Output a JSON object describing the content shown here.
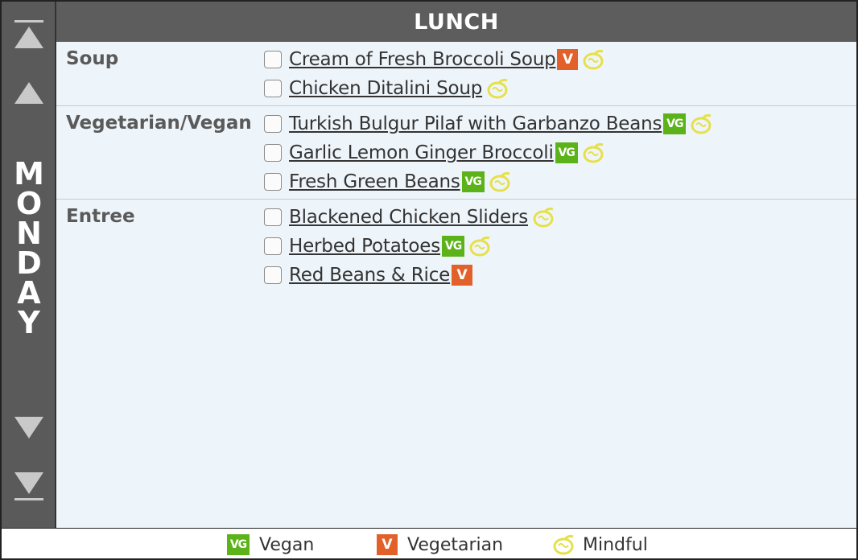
{
  "header": {
    "title": "LUNCH"
  },
  "sidebar": {
    "day_letters": [
      "M",
      "O",
      "N",
      "D",
      "A",
      "Y"
    ],
    "nav": {
      "first_label": "first",
      "prev_label": "previous",
      "next_label": "next",
      "last_label": "last"
    }
  },
  "sections": [
    {
      "category": "Soup",
      "items": [
        {
          "name": "Cream of Fresh Broccoli Soup",
          "badge": "V",
          "mindful": true
        },
        {
          "name": "Chicken Ditalini Soup",
          "badge": "",
          "mindful": true
        }
      ]
    },
    {
      "category": "Vegetarian/Vegan",
      "items": [
        {
          "name": "Turkish Bulgur Pilaf with Garbanzo Beans",
          "badge": "VG",
          "mindful": true
        },
        {
          "name": "Garlic Lemon Ginger Broccoli",
          "badge": "VG",
          "mindful": true
        },
        {
          "name": "Fresh Green Beans",
          "badge": "VG",
          "mindful": true
        }
      ]
    },
    {
      "category": "Entree",
      "items": [
        {
          "name": "Blackened Chicken Sliders",
          "badge": "",
          "mindful": true
        },
        {
          "name": "Herbed Potatoes",
          "badge": "VG",
          "mindful": true
        },
        {
          "name": "Red Beans & Rice",
          "badge": "V",
          "mindful": false
        }
      ]
    }
  ],
  "legend": {
    "vegan_badge": "VG",
    "vegan_label": "Vegan",
    "vegetarian_badge": "V",
    "vegetarian_label": "Vegetarian",
    "mindful_label": "Mindful"
  },
  "colors": {
    "vegan": "#5cb319",
    "vegetarian": "#e2612a",
    "mindful": "#e6e04a",
    "header_bg": "#5d5d5d"
  }
}
